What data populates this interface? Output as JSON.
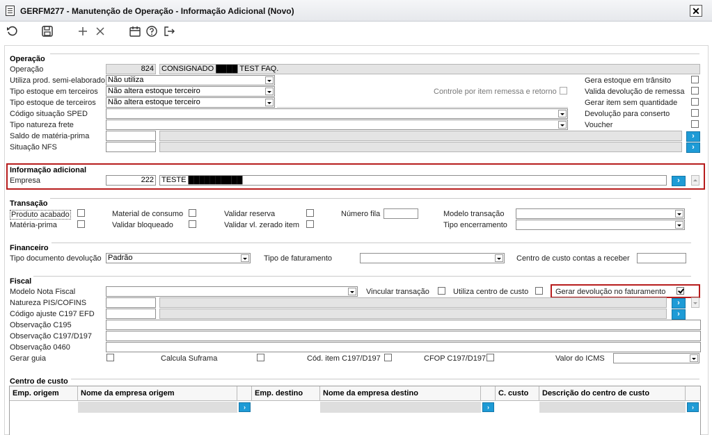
{
  "window": {
    "title": "GERFM277 - Manutenção de Operação - Informação Adicional (Novo)",
    "close_glyph": "✕"
  },
  "toolbar": {
    "icons": [
      "undo-icon",
      "save-icon",
      "add-icon",
      "delete-icon",
      "calendar-icon",
      "help-icon",
      "exit-icon"
    ]
  },
  "operacao": {
    "title": "Operação",
    "operacao_label": "Operação",
    "operacao_code": "824",
    "operacao_desc": "CONSIGNADO ████ TEST FAQ.",
    "semi_label": "Utiliza prod. semi-elaborado",
    "semi_value": "Não utiliza",
    "estoque_em_label": "Tipo estoque em terceiros",
    "estoque_em_value": "Não altera estoque terceiro",
    "estoque_de_label": "Tipo estoque de terceiros",
    "estoque_de_value": "Não altera estoque terceiro",
    "sped_label": "Código situação SPED",
    "sped_value": "",
    "frete_label": "Tipo natureza frete",
    "frete_value": "",
    "saldo_label": "Saldo de matéria-prima",
    "nfs_label": "Situação NFS",
    "controle_label": "Controle por item remessa e retorno",
    "gera_estoque_label": "Gera estoque em trânsito",
    "valida_dev_label": "Valida devolução de remessa",
    "gerar_item_label": "Gerar item sem quantidade",
    "dev_conserto_label": "Devolução para conserto",
    "voucher_label": "Voucher"
  },
  "info": {
    "title": "Informação adicional",
    "empresa_label": "Empresa",
    "empresa_code": "222",
    "empresa_name": "TESTE ██████████"
  },
  "transacao": {
    "title": "Transação",
    "produto_acabado": "Produto acabado",
    "materia_prima": "Matéria-prima",
    "material_consumo": "Material de consumo",
    "validar_bloqueado": "Validar bloqueado",
    "validar_reserva": "Validar reserva",
    "validar_zerado": "Validar vl. zerado item",
    "numero_fila": "Número fila",
    "modelo_transacao": "Modelo transação",
    "tipo_encerramento": "Tipo encerramento"
  },
  "financeiro": {
    "title": "Financeiro",
    "tipo_doc_label": "Tipo documento devolução",
    "tipo_doc_value": "Padrão",
    "tipo_fat_label": "Tipo de faturamento",
    "tipo_fat_value": "",
    "centro_label": "Centro de custo contas a receber"
  },
  "fiscal": {
    "title": "Fiscal",
    "modelo_label": "Modelo Nota Fiscal",
    "vincular_label": "Vincular transação",
    "utiliza_cc_label": "Utiliza centro de custo",
    "gerar_dev_label": "Gerar devolução no faturamento",
    "natureza_label": "Natureza PIS/COFINS",
    "ajuste_label": "Código ajuste C197 EFD",
    "obs_c195_label": "Observação C195",
    "obs_c197_label": "Observação C197/D197",
    "obs_0460_label": "Observação 0460",
    "gerar_guia_label": "Gerar guia",
    "suframa_label": "Calcula Suframa",
    "cod_item_label": "Cód. item C197/D197",
    "cfop_label": "CFOP C197/D197",
    "icms_label": "Valor do ICMS"
  },
  "centro_custo": {
    "title": "Centro de custo",
    "columns": [
      "Emp. origem",
      "Nome da empresa origem",
      "Emp. destino",
      "Nome da empresa destino",
      "C. custo",
      "Descrição do centro de custo"
    ]
  },
  "colors": {
    "accent": "#1e9bd6",
    "highlight_border": "#b71c1c",
    "readonly_bg": "#e4e4e4"
  }
}
